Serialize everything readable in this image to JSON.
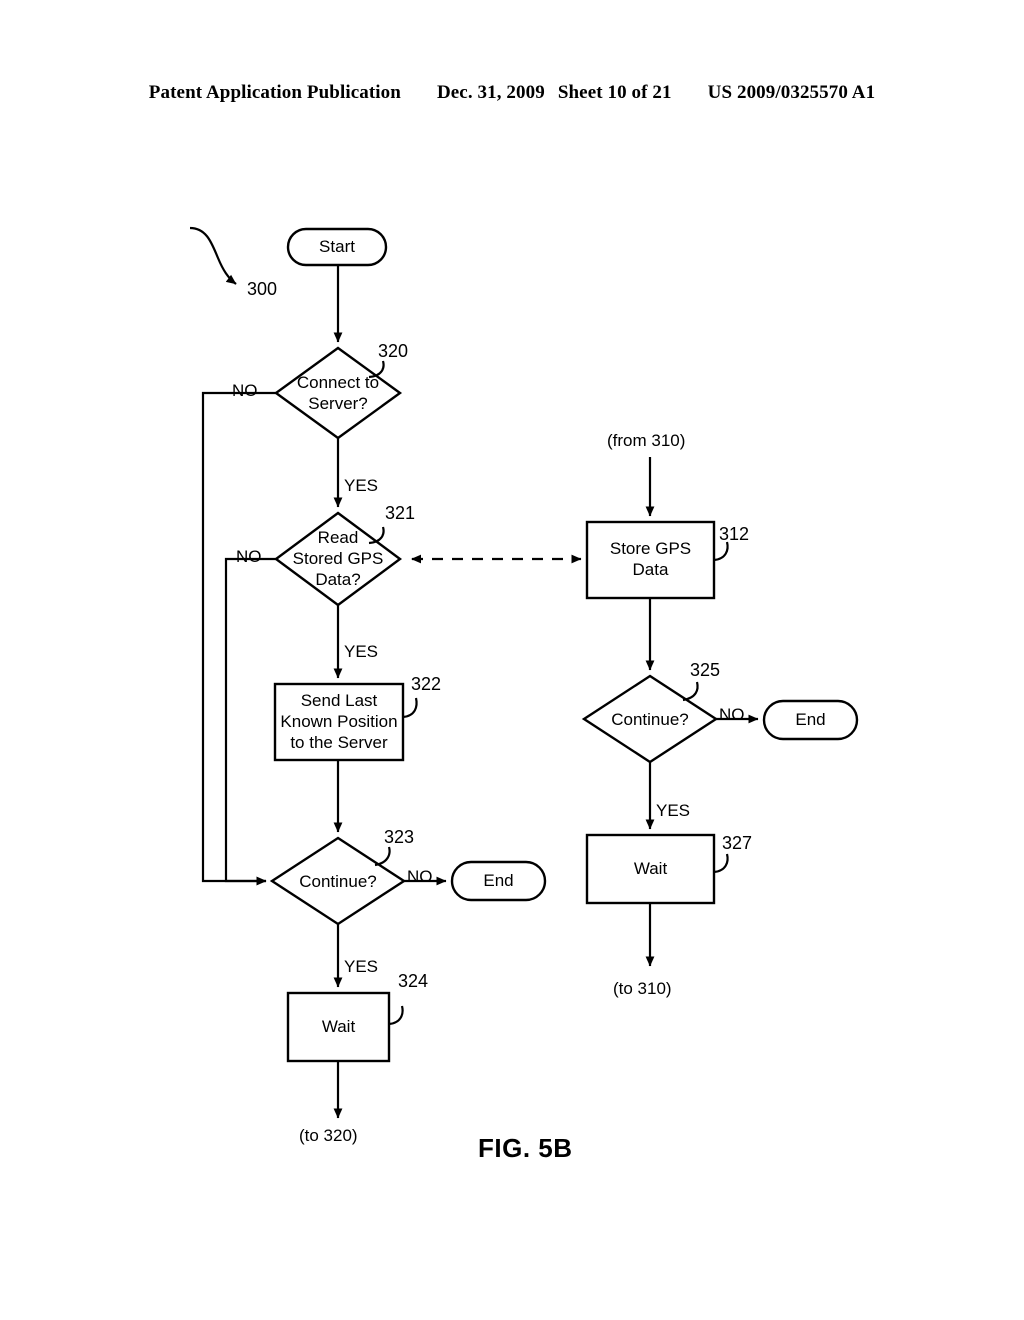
{
  "header": {
    "publication": "Patent Application Publication",
    "date": "Dec. 31, 2009",
    "sheet": "Sheet 10 of 21",
    "number": "US 2009/0325570 A1"
  },
  "figure": {
    "caption": "FIG. 5B",
    "diagram_ref": "300"
  },
  "nodes": {
    "start": {
      "label": "Start",
      "shape": "terminator"
    },
    "connect_server": {
      "label": "Connect to\nServer?",
      "shape": "decision",
      "ref": "320"
    },
    "read_stored_gps": {
      "label": "Read\nStored GPS\nData?",
      "shape": "decision",
      "ref": "321"
    },
    "send_last_known": {
      "label": "Send Last\nKnown Position\nto the Server",
      "shape": "process",
      "ref": "322"
    },
    "continue_left": {
      "label": "Continue?",
      "shape": "decision",
      "ref": "323"
    },
    "end_left": {
      "label": "End",
      "shape": "terminator"
    },
    "wait_left": {
      "label": "Wait",
      "shape": "process",
      "ref": "324"
    },
    "store_gps": {
      "label": "Store GPS\nData",
      "shape": "process",
      "ref": "312"
    },
    "continue_right": {
      "label": "Continue?",
      "shape": "decision",
      "ref": "325"
    },
    "end_right": {
      "label": "End",
      "shape": "terminator"
    },
    "wait_right": {
      "label": "Wait",
      "shape": "process",
      "ref": "327"
    }
  },
  "edge_labels": {
    "connect_no": "NO",
    "connect_yes": "YES",
    "read_no": "NO",
    "read_yes": "YES",
    "continue_left_no": "NO",
    "continue_left_yes": "YES",
    "continue_right_no": "NO",
    "continue_right_yes": "YES"
  },
  "connectors": {
    "from_310": "(from 310)",
    "to_310": "(to 310)",
    "to_320": "(to 320)"
  },
  "colors": {
    "line": "#000000",
    "fill": "#ffffff",
    "text": "#000000"
  }
}
